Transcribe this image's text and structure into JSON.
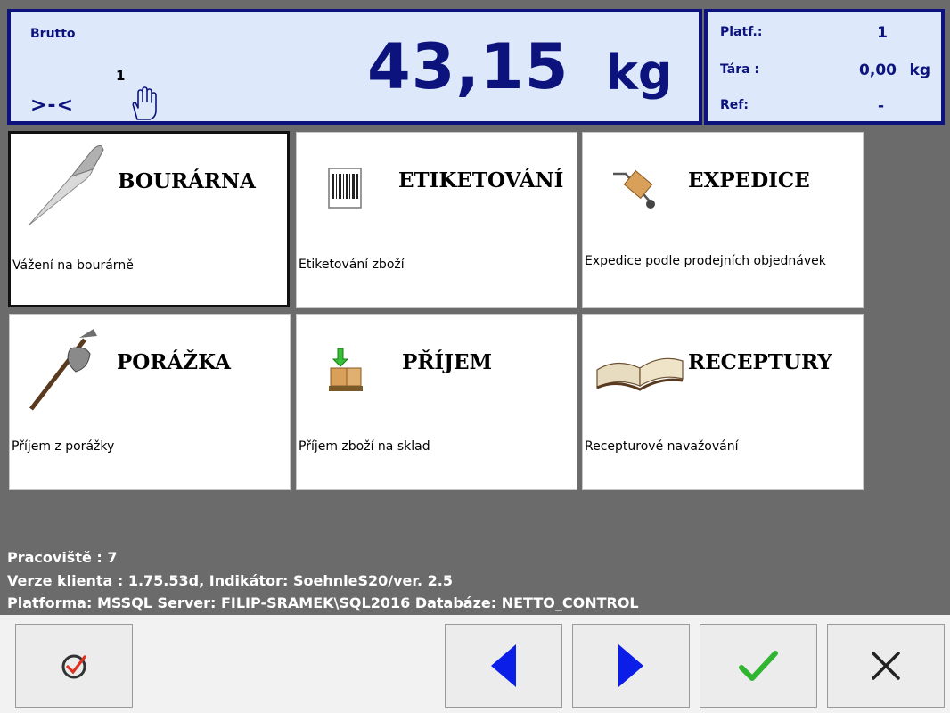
{
  "scale": {
    "mode_label": "Brutto",
    "platform_number": "1",
    "zero_indicator": ">-<",
    "weight": "43,15",
    "unit": "kg"
  },
  "info": {
    "platform_label": "Platf.:",
    "platform_value": "1",
    "tare_label": "Tára :",
    "tare_value": "0,00",
    "tare_unit": "kg",
    "ref_label": "Ref:",
    "ref_value": "-"
  },
  "tiles": [
    {
      "title": "BOURÁRNA",
      "desc": "Vážení na bourárně",
      "icon": "knife-icon"
    },
    {
      "title": "ETIKETOVÁNÍ",
      "desc": "Etiketování zboží",
      "icon": "barcode-icon"
    },
    {
      "title": "EXPEDICE",
      "desc": "Expedice podle prodejních objednávek",
      "icon": "hand-truck-icon"
    },
    {
      "title": "PORÁŽKA",
      "desc": "Příjem z porážky",
      "icon": "axe-icon"
    },
    {
      "title": "PŘÍJEM",
      "desc": "Příjem zboží na sklad",
      "icon": "receive-boxes-icon"
    },
    {
      "title": "RECEPTURY",
      "desc": "Recepturové navažování",
      "icon": "open-book-icon"
    }
  ],
  "status": {
    "workplace": "Pracoviště : 7",
    "client": "Verze klienta : 1.75.53d, Indikátor: SoehnleS20/ver. 2.5",
    "platform": "Platforma: MSSQL  Server: FILIP-SRAMEK\\SQL2016  Databáze: NETTO_CONTROL"
  },
  "toolbar": {
    "buttons": [
      "refresh-check-icon",
      "arrow-left-icon",
      "arrow-right-icon",
      "checkmark-icon",
      "close-icon"
    ],
    "colors": {
      "arrow": "#0a1ee8",
      "check": "#2fb52f"
    }
  }
}
